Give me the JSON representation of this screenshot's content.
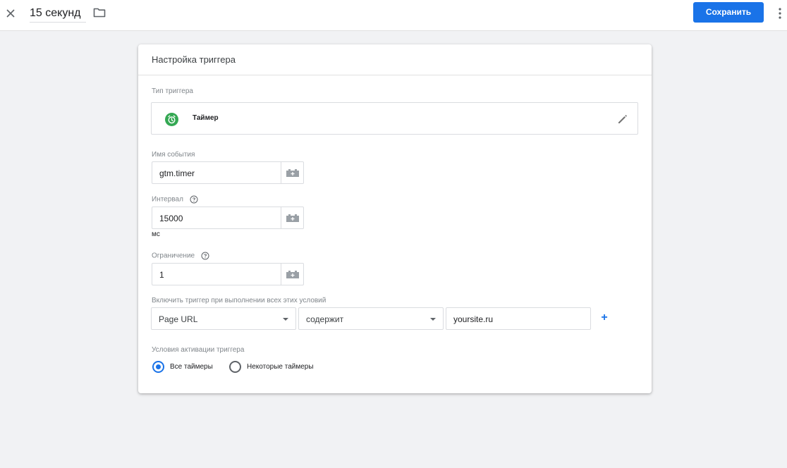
{
  "topbar": {
    "title": "15 секунд",
    "save_label": "Сохранить",
    "icons": [
      "close-icon",
      "folder-icon",
      "more-vert-icon"
    ]
  },
  "card": {
    "title": "Настройка триггера",
    "trigger_type": {
      "label": "Тип триггера",
      "value": "Таймер",
      "icon": "timer-icon",
      "icon_color": "#34a853"
    },
    "event_name": {
      "label": "Имя события",
      "value": "gtm.timer"
    },
    "interval": {
      "label": "Интервал",
      "value": "15000",
      "unit": "мс"
    },
    "limit": {
      "label": "Ограничение",
      "value": "1"
    },
    "conditions": {
      "label": "Включить триггер при выполнении всех этих условий",
      "variable": "Page URL",
      "operator": "содержит",
      "value": "yoursite.ru",
      "add_label": "+"
    },
    "activation": {
      "label": "Условия активации триггера",
      "options": [
        {
          "label": "Все таймеры",
          "checked": true
        },
        {
          "label": "Некоторые таймеры",
          "checked": false
        }
      ]
    }
  },
  "colors": {
    "accent": "#1a73e8",
    "background": "#f1f2f4"
  }
}
